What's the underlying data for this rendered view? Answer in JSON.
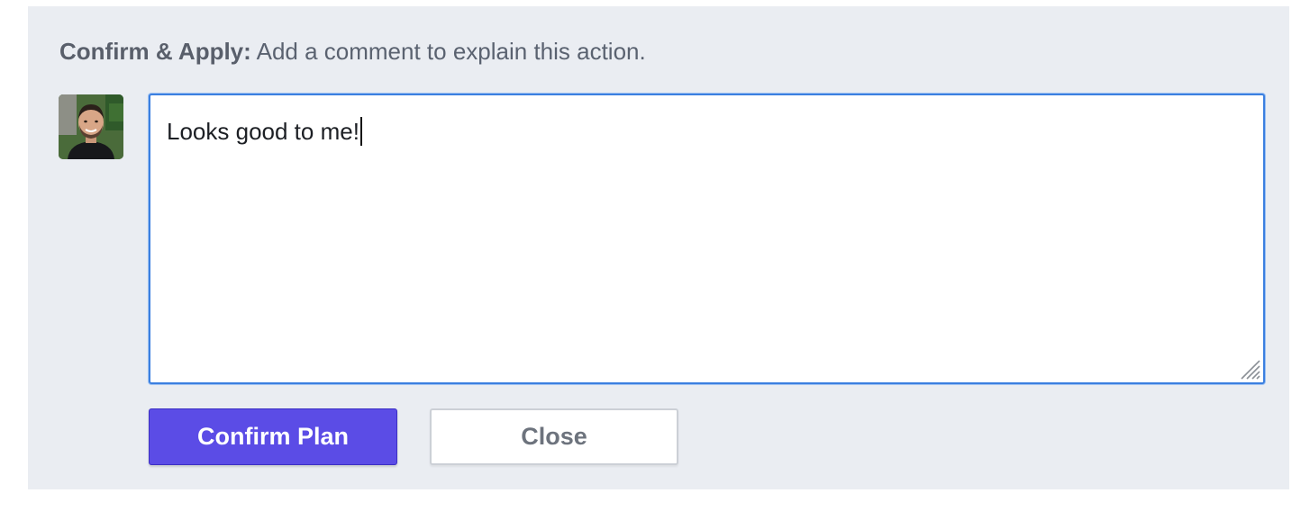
{
  "prompt": {
    "strong": "Confirm & Apply:",
    "text": " Add a comment to explain this action."
  },
  "comment": {
    "value": "Looks good to me!"
  },
  "buttons": {
    "confirm_label": "Confirm Plan",
    "close_label": "Close"
  },
  "colors": {
    "panel_bg": "#eaedf2",
    "primary": "#5b4ce6",
    "focus_border": "#3b7fe0"
  }
}
